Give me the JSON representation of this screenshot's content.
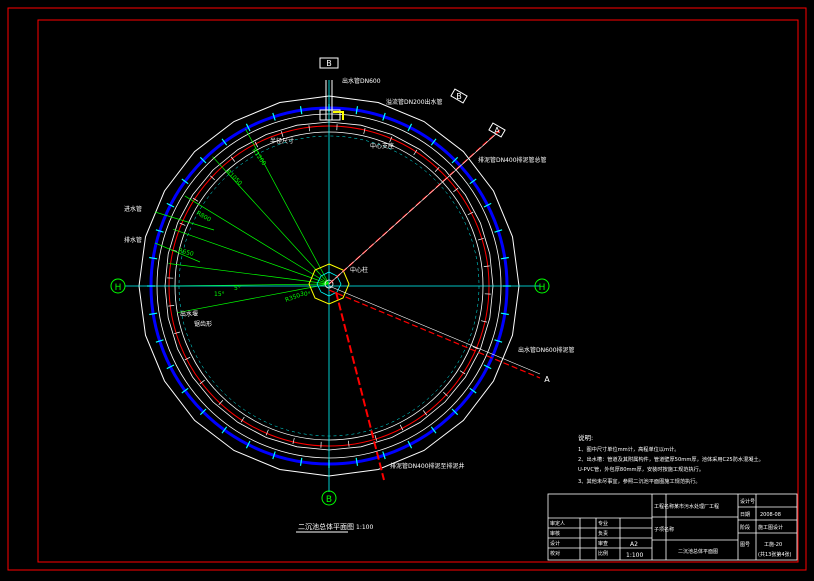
{
  "drawing": {
    "title": "二沉池总体平面图",
    "scale": "1:100",
    "axis_top": "B",
    "axis_left": "H",
    "axis_right": "H",
    "axis_bottom": "B",
    "section_b": "B",
    "section_a1": "A",
    "section_a2": "A",
    "labels": {
      "inlet_pipe": "出水管DN600",
      "outlet_pipe": "溢流管DN200出水管",
      "pipe_a": "排泥管DN400排泥管总管",
      "pipe_left1": "进水管",
      "pipe_left2": "排水管",
      "bearing": "中心支座",
      "pipe_right": "出水管DN600排泥管",
      "pipe_bottom": "排泥管DN400排泥至排泥井",
      "radius_note": "半径尺寸",
      "angle_note": "出水堰",
      "side_note": "锯齿形",
      "center_label": "中心柱"
    },
    "radial_dims": [
      "R1200",
      "R1050",
      "R800",
      "R650",
      "R350"
    ],
    "angle_dims": [
      "5°",
      "15°",
      "30°"
    ],
    "notes": {
      "heading": "说明:",
      "line1": "1、图中尺寸单位mm计，高程单位以m计。",
      "line2": "2、出水槽：管道及其附属构件，管道壁厚50mm厚，池体采用C25防水混凝土。",
      "line3": "U-PVC管，外包厚80mm厚，安装时按施工规范执行。",
      "line4": "3、其他未尽事宜，参照二沉池平面图施工规范执行。"
    },
    "title_block": {
      "project_label": "工程名称",
      "project": "某市污水处理厂工程",
      "sub_label": "子项名称",
      "drawing_name": "二沉池总体平面图",
      "no_label": "设计号",
      "no_value": "2008-08",
      "date_label": "日期",
      "stage_label": "阶段",
      "stage": "施工图设计",
      "sheet_label": "图号",
      "sheet": "工施-20",
      "sheet_sub": "(共13张第4张)",
      "size": "A2",
      "scale": "1:100",
      "roles": [
        "审定人",
        "审核",
        "设计",
        "校对",
        "制图"
      ],
      "roles2": [
        "专业",
        "负责",
        "审查",
        "比例"
      ]
    }
  }
}
